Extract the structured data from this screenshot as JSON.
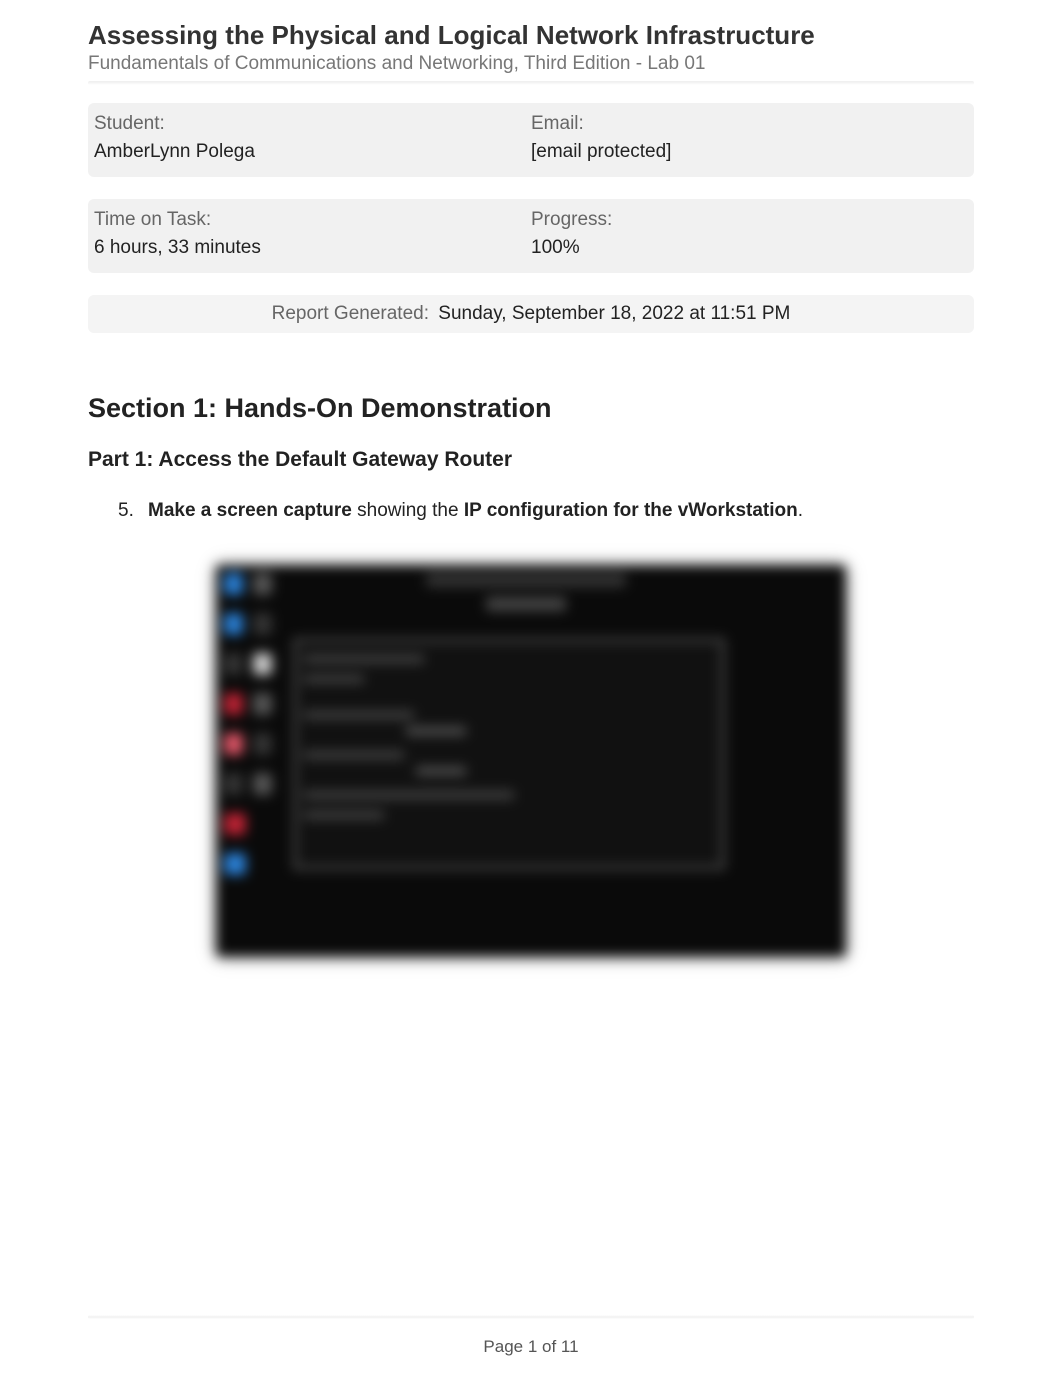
{
  "header": {
    "title": "Assessing the Physical and Logical Network Infrastructure",
    "subtitle": "Fundamentals of Communications and Networking, Third Edition - Lab 01"
  },
  "student_info": {
    "student_label": "Student:",
    "student_value": "AmberLynn Polega",
    "email_label": "Email:",
    "email_value": "[email protected]"
  },
  "task_info": {
    "time_label": "Time on Task:",
    "time_value": "6 hours, 33 minutes",
    "progress_label": "Progress:",
    "progress_value": "100%"
  },
  "report": {
    "label": "Report Generated:",
    "value": "Sunday, September 18, 2022 at 11:51 PM"
  },
  "section": {
    "heading": "Section 1: Hands-On Demonstration",
    "part_heading": "Part 1: Access the Default Gateway Router"
  },
  "step": {
    "number": "5.",
    "bold1": "Make a screen capture",
    "mid": " showing the ",
    "bold2": "IP configuration for the vWorkstation",
    "end": "."
  },
  "footer": {
    "page": "Page 1 of 11"
  }
}
